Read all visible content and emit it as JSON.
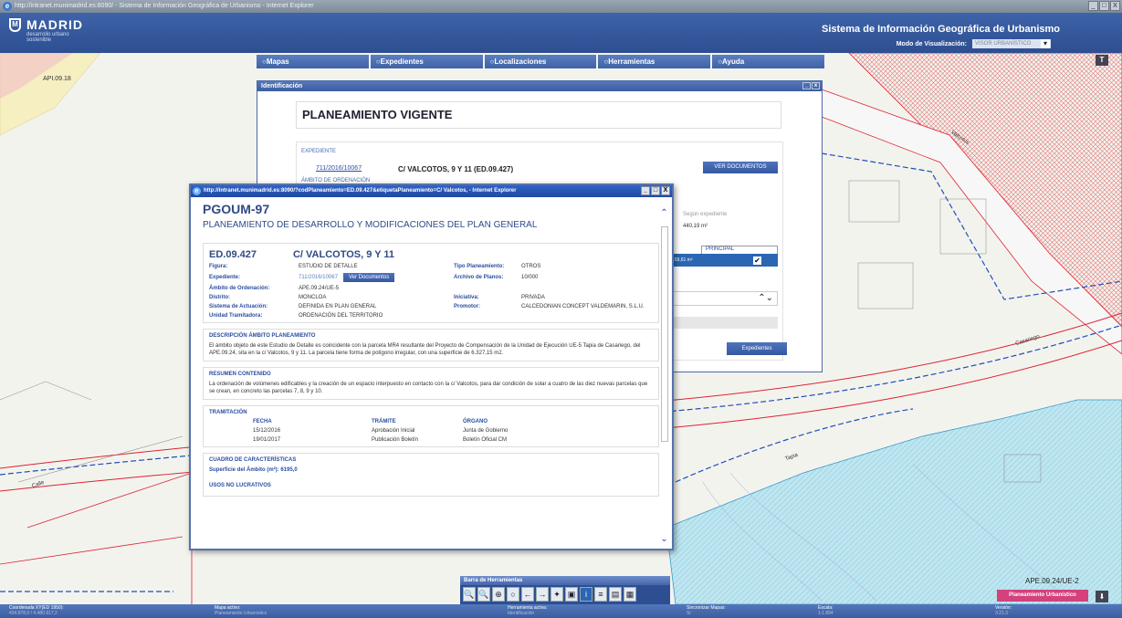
{
  "window": {
    "title": "http://intranet.munimadrid.es:8090/ - Sistema de Información Geográfica de Urbanismo - Internet Explorer",
    "controls": [
      "_",
      "□",
      "X"
    ]
  },
  "header": {
    "city": "MADRID",
    "subtitle1": "desarrollo urbano",
    "subtitle2": "sostenible",
    "system_title": "Sistema de Información Geográfica de Urbanismo",
    "mode_label": "Modo de Visualización:",
    "mode_value": "VISOR URBANÍSTICO"
  },
  "menu": {
    "items": [
      "Mapas",
      "Expedientes",
      "Localizaciones",
      "Herramientas",
      "Ayuda"
    ]
  },
  "ident": {
    "window_title": "Identificación",
    "heading": "PLANEAMIENTO VIGENTE",
    "expediente_label": "EXPEDIENTE",
    "expediente_link": "711/2016/10067",
    "expediente_name": "C/ VALCOTOS, 9 Y 11 (ED.09.427)",
    "ver_docs": "VER DOCUMENTOS",
    "ambito_label": "ÁMBITO DE ORDENACIÓN",
    "segun": "Según expediente",
    "superficie": "440,19 m²",
    "principal_header": "PRINCIPAL",
    "principal_value": "159,61 m²",
    "principal_check": "✔",
    "dd_arrows": "⌃⌄",
    "expedientes_btn": "Expedientes"
  },
  "popup": {
    "title": "http://intranet.munimadrid.es:8090/?codPlaneamiento=ED.09.427&etiquetaPlaneamiento=C/ Valcotos, - Internet Explorer",
    "pg": "PGOUM-97",
    "pg_sub": "PLANEAMIENTO DE DESARROLLO Y MODIFICACIONES DEL PLAN GENERAL",
    "code": "ED.09.427",
    "name": "C/ VALCOTOS, 9 Y 11",
    "fields": {
      "figura_k": "Figura:",
      "figura_v": "ESTUDIO DE DETALLE",
      "tipo_k": "Tipo Planeamiento:",
      "tipo_v": "OTROS",
      "exp_k": "Expediente:",
      "exp_v": "711/2016/10067",
      "ver_docs": "Ver Documentos",
      "archivo_k": "Archivo de Planos:",
      "archivo_v": "10/000",
      "ambito_k": "Ámbito de Ordenación:",
      "ambito_v": "APE.09.24/UE-5",
      "distrito_k": "Distrito:",
      "distrito_v": "MONCLOA",
      "iniciativa_k": "Iniciativa:",
      "iniciativa_v": "PRIVADA",
      "sistema_k": "Sistema de Actuación:",
      "sistema_v": "DEFINIDA EN PLAN GENERAL",
      "promotor_k": "Promotor:",
      "promotor_v": "CALCEDONIAN CONCEPT VALDEMARIN, S.L.U.",
      "unidad_k": "Unidad Tramitadora:",
      "unidad_v": "ORDENACIÓN DEL TERRITORIO"
    },
    "desc_title": "DESCRIPCIÓN ÁMBITO PLANEAMIENTO",
    "desc_text": "El ámbito objeto de este Estudio de Detalle es coincidente con la parcela MR4 resultante del Proyecto de Compensación de la Unidad de Ejecución UE-5 Tapia de Casariego, del APE.09.24, sita en la c/ Valcotos, 9 y 11. La parcela tiene forma de polígono irregular, con una superficie de 6.327,15 m2.",
    "resumen_title": "RESUMEN CONTENIDO",
    "resumen_text": "La ordenación de volúmenes edificables y la creación de un espacio interpuesto en contacto con la c/ Valcotos, para dar condición de solar a cuatro de las diez nuevas parcelas que se crean, en concreto las parcelas 7, 8, 9 y 10.",
    "tram_title": "TRAMITACIÓN",
    "tram_headers": [
      "FECHA",
      "TRÁMITE",
      "ÓRGANO"
    ],
    "tram_rows": [
      [
        "15/12/2016",
        "Aprobación Inicial",
        "Junta de Gobierno"
      ],
      [
        "19/01/2017",
        "Publicación Boletín",
        "Boletín Oficial CM"
      ]
    ],
    "cuadro_title": "CUADRO DE CARACTERÍSTICAS",
    "superficie_k": "Superficie del Ámbito (m²):",
    "superficie_v": "6195,0",
    "usos_title": "USOS NO LUCRATIVOS",
    "scroll_up": "⌃",
    "scroll_down": "⌄"
  },
  "toolbar": {
    "title": "Barra de Herramientas",
    "tools": [
      "🔍",
      "🔍",
      "⊕",
      "○",
      "←",
      "→",
      "✦",
      "▣",
      "i",
      "≡",
      "▤",
      "▦"
    ]
  },
  "map": {
    "labels": {
      "api": "API.09.18",
      "valcotos": "Valcotos",
      "casariego": "Casariego",
      "tapia": "Tapia",
      "calle": "Calle",
      "ape": "APE.09.24/UE-2",
      "pl_btn": "Planeamiento Urbanístico",
      "t_btn": "T",
      "dl_btn": "⬇"
    }
  },
  "status": {
    "coord_label": "Coordenada XY(ED 1950):",
    "coord_value": "434.878,0 / 4.480.917,2",
    "mapa_label": "Mapa activo:",
    "mapa_value": "Planeamiento Urbanístico",
    "herr_label": "Herramienta activa:",
    "herr_value": "Identificación",
    "sinc_label": "Sincronizar Mapas:",
    "sinc_value": "Si",
    "escala_label": "Escala:",
    "escala_value": "1:1.894",
    "version_label": "Versión:",
    "version_value": "3.21.3"
  }
}
